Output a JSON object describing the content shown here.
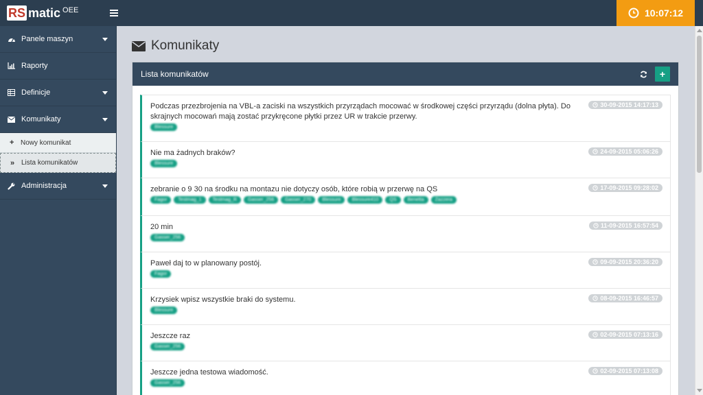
{
  "brand": {
    "rs": "RS",
    "matic": "matic",
    "oee": "OEE"
  },
  "clock": {
    "time": "10:07:12"
  },
  "sidebar": {
    "items": [
      {
        "label": "Panele maszyn",
        "icon": "dashboard-icon",
        "caret": true
      },
      {
        "label": "Raporty",
        "icon": "bar-chart-icon",
        "caret": false
      },
      {
        "label": "Definicje",
        "icon": "table-icon",
        "caret": true
      },
      {
        "label": "Komunikaty",
        "icon": "envelope-icon",
        "caret": true
      },
      {
        "label": "Administracja",
        "icon": "wrench-icon",
        "caret": true
      }
    ],
    "subitems": [
      {
        "label": "Nowy komunikat",
        "icon": "plus-icon"
      },
      {
        "label": "Lista komunikatów",
        "icon": "double-chevron-icon"
      }
    ]
  },
  "page": {
    "title": "Komunikaty"
  },
  "box": {
    "title": "Lista komunikatów"
  },
  "messages": [
    {
      "text": "Podczas przezbrojenia na VBL-a zaciski na wszystkich przyrządach mocować w środkowej części przyrządu (dolna płyta). Do skrajnych mocowań mają zostać przykręcone płytki przez UR w trakcie przerwy.",
      "date": "30-09-2015 14:17:13",
      "tags": [
        "Blessure"
      ]
    },
    {
      "text": "Nie ma żadnych braków?",
      "date": "24-09-2015 05:06:26",
      "tags": [
        "Blessure"
      ]
    },
    {
      "text": "zebranie o 9 30 na środku na montazu nie dotyczy osób, które robią w przerwę na QS",
      "date": "17-09-2015 09:28:02",
      "tags": [
        "Fagor",
        "Testmag_1",
        "Testmag_R",
        "Gasser_256",
        "Gasser_270",
        "Blessure",
        "Blessure410",
        "QS",
        "Benetta",
        "Zazzera"
      ]
    },
    {
      "text": "20 min",
      "date": "11-09-2015 16:57:54",
      "tags": [
        "Gasser_256"
      ]
    },
    {
      "text": "Paweł daj to w planowany postój.",
      "date": "09-09-2015 20:36:20",
      "tags": [
        "Fagor"
      ]
    },
    {
      "text": "Krzysiek wpisz wszystkie braki do systemu.",
      "date": "08-09-2015 16:46:57",
      "tags": [
        "Blessure"
      ]
    },
    {
      "text": "Jeszcze raz",
      "date": "02-09-2015 07:13:16",
      "tags": [
        "Gasser_256"
      ]
    },
    {
      "text": "Jeszcze jedna testowa wiadomość.",
      "date": "02-09-2015 07:13:08",
      "tags": [
        "Gasser_256"
      ]
    }
  ],
  "colors": {
    "accent": "#16a085",
    "topbar": "#2c3e50",
    "sidebar": "#34495e",
    "clock": "#f39c12"
  }
}
